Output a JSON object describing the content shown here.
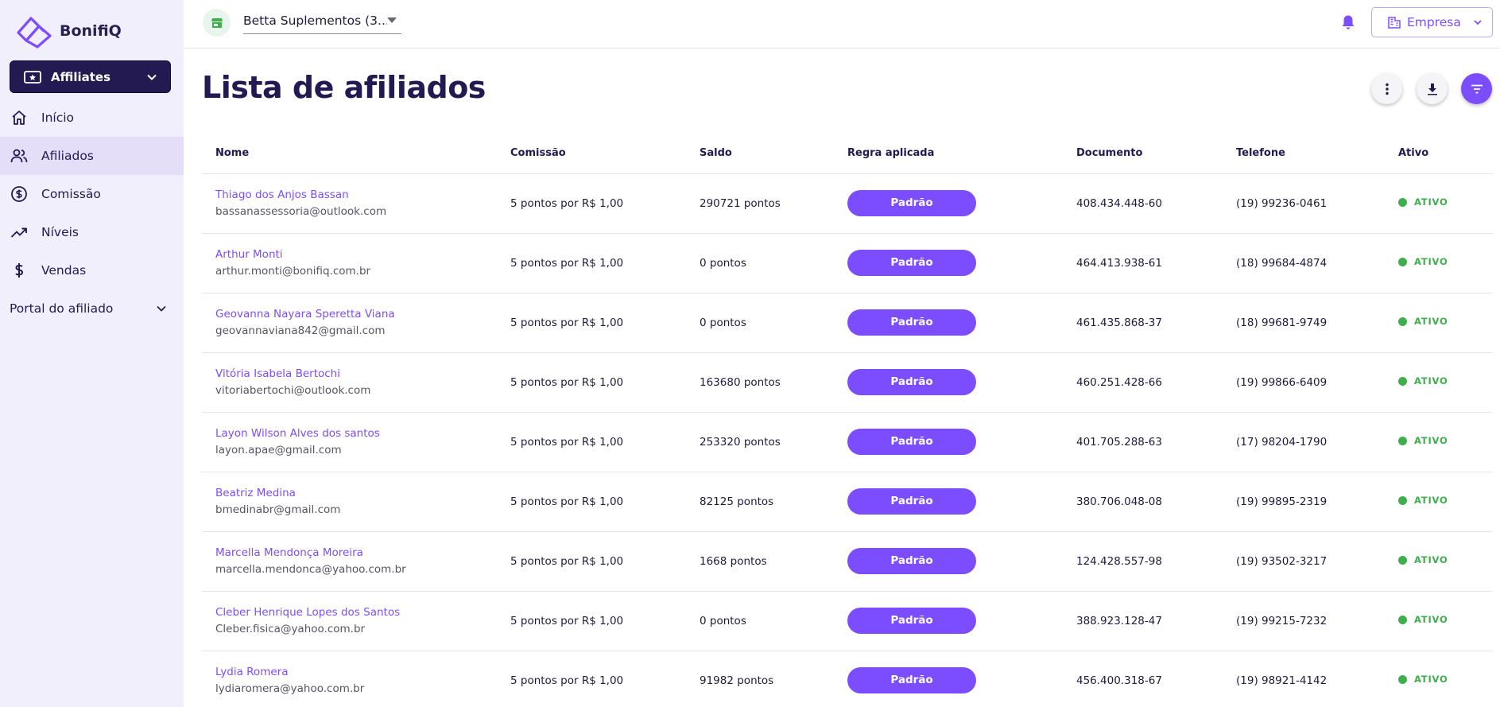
{
  "brand": {
    "name": "BonifiQ",
    "accent": "#7c4dff",
    "sidebar_dark": "#231a52"
  },
  "sidebar": {
    "module_label": "Affiliates",
    "items": [
      {
        "label": "Início",
        "icon": "home-icon"
      },
      {
        "label": "Afiliados",
        "icon": "users-icon",
        "active": true
      },
      {
        "label": "Comissão",
        "icon": "dollar-circle-icon"
      },
      {
        "label": "Níveis",
        "icon": "trending-up-icon"
      },
      {
        "label": "Vendas",
        "icon": "dollar-icon"
      }
    ],
    "group_label": "Portal do afiliado"
  },
  "topbar": {
    "store_name": "Betta Suplementos (3...",
    "empresa_label": "Empresa"
  },
  "page": {
    "title": "Lista de afiliados"
  },
  "table": {
    "columns": [
      "Nome",
      "Comissão",
      "Saldo",
      "Regra aplicada",
      "Documento",
      "Telefone",
      "Ativo"
    ],
    "rows": [
      {
        "name": "Thiago dos Anjos Bassan",
        "email": "bassanassessoria@outlook.com",
        "commission": "5 pontos por R$ 1,00",
        "balance": "290721 pontos",
        "rule": "Padrão",
        "document": "408.434.448-60",
        "phone": "(19) 99236-0461",
        "status": "ATIVO"
      },
      {
        "name": "Arthur Monti",
        "email": "arthur.monti@bonifiq.com.br",
        "commission": "5 pontos por R$ 1,00",
        "balance": "0 pontos",
        "rule": "Padrão",
        "document": "464.413.938-61",
        "phone": "(18) 99684-4874",
        "status": "ATIVO"
      },
      {
        "name": "Geovanna Nayara Speretta Viana",
        "email": "geovannaviana842@gmail.com",
        "commission": "5 pontos por R$ 1,00",
        "balance": "0 pontos",
        "rule": "Padrão",
        "document": "461.435.868-37",
        "phone": "(18) 99681-9749",
        "status": "ATIVO"
      },
      {
        "name": "Vitória Isabela Bertochi",
        "email": "vitoriabertochi@outlook.com",
        "commission": "5 pontos por R$ 1,00",
        "balance": "163680 pontos",
        "rule": "Padrão",
        "document": "460.251.428-66",
        "phone": "(19) 99866-6409",
        "status": "ATIVO"
      },
      {
        "name": "Layon Wilson Alves dos santos",
        "email": "layon.apae@gmail.com",
        "commission": "5 pontos por R$ 1,00",
        "balance": "253320 pontos",
        "rule": "Padrão",
        "document": "401.705.288-63",
        "phone": "(17) 98204-1790",
        "status": "ATIVO"
      },
      {
        "name": "Beatriz Medina",
        "email": "bmedinabr@gmail.com",
        "commission": "5 pontos por R$ 1,00",
        "balance": "82125 pontos",
        "rule": "Padrão",
        "document": "380.706.048-08",
        "phone": "(19) 99895-2319",
        "status": "ATIVO"
      },
      {
        "name": "Marcella Mendonça Moreira",
        "email": "marcella.mendonca@yahoo.com.br",
        "commission": "5 pontos por R$ 1,00",
        "balance": "1668 pontos",
        "rule": "Padrão",
        "document": "124.428.557-98",
        "phone": "(19) 93502-3217",
        "status": "ATIVO"
      },
      {
        "name": "Cleber Henrique Lopes dos Santos",
        "email": "Cleber.fisica@yahoo.com.br",
        "commission": "5 pontos por R$ 1,00",
        "balance": "0 pontos",
        "rule": "Padrão",
        "document": "388.923.128-47",
        "phone": "(19) 99215-7232",
        "status": "ATIVO"
      },
      {
        "name": "Lydia Romera",
        "email": "lydiaromera@yahoo.com.br",
        "commission": "5 pontos por R$ 1,00",
        "balance": "91982 pontos",
        "rule": "Padrão",
        "document": "456.400.318-67",
        "phone": "(19) 98921-4142",
        "status": "ATIVO"
      }
    ]
  }
}
